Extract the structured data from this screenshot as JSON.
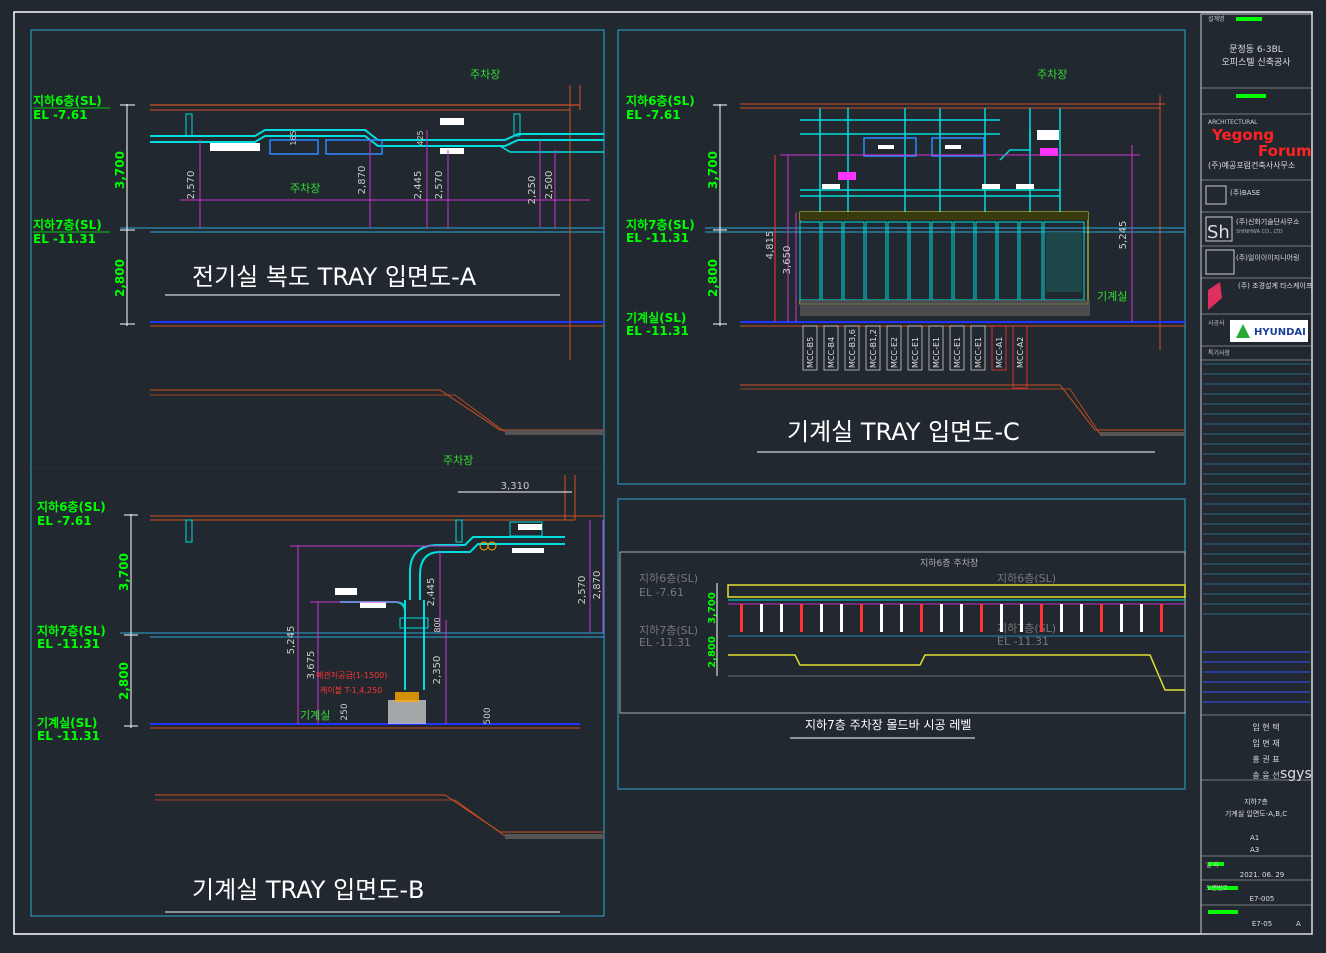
{
  "panelA": {
    "title": "전기실 복도 TRAY 입면도-A",
    "top_label": "주차장",
    "mid_label": "주차장",
    "level1": "지하6층(SL)",
    "el1": "EL -7.61",
    "level2": "지하7층(SL)",
    "el2": "EL -11.31",
    "dim_v1": "3,700",
    "dim_v2": "2,800",
    "dims": [
      "2,570",
      "2,870",
      "2,445",
      "2,570",
      "2,250",
      "2,500"
    ],
    "small_dims": [
      "165",
      "425"
    ]
  },
  "panelB": {
    "title": "기계실 TRAY 입면도-B",
    "top_label": "주차장",
    "level1": "지하6층(SL)",
    "el1": "EL -7.61",
    "level2": "지하7층(SL)",
    "el2": "EL -11.31",
    "level3": "기계실(SL)",
    "el3": "EL -11.31",
    "dim_v1": "3,700",
    "dim_v2": "2,800",
    "dim_top": "3,310",
    "dims": [
      "5,245",
      "3,675",
      "2,445",
      "2,350",
      "2,570",
      "2,870",
      "800",
      "500",
      "250"
    ],
    "room_label": "기계실",
    "notes": [
      "배관저공급(1-1500)",
      "케이블 T-1,4,250"
    ]
  },
  "panelC": {
    "title": "기계실 TRAY 입면도-C",
    "top_label": "주차장",
    "level1": "지하6층(SL)",
    "el1": "EL -7.61",
    "level2": "지하7층(SL)",
    "el2": "EL -11.31",
    "level3": "기계실(SL)",
    "el3": "EL -11.31",
    "dim_v1": "3,700",
    "dim_v2": "2,800",
    "dims": [
      "4,815",
      "3,650",
      "5,245"
    ],
    "room_label": "기계실",
    "mcc": [
      "MCC-B5",
      "MCC-B4",
      "MCC-B3,6",
      "MCC-B1,2",
      "MCC-E2",
      "MCC-E1",
      "MCC-E1",
      "MCC-E1",
      "MCC-E1",
      "MCC-A1",
      "MCC-A2"
    ]
  },
  "panelD": {
    "title": "지하7층 주차장 몰드바 시공 레벨",
    "top_label": "지하6층 주차장",
    "left_level1": "지하6층(SL)",
    "left_el1": "EL -7.61",
    "left_level2": "지하7층(SL)",
    "left_el2": "EL -11.31",
    "right_level1": "지하6층(SL)",
    "right_level2": "지하7층(SL)",
    "right_el2": "EL -11.31",
    "dim_v1": "3,700",
    "dim_v2": "2,800"
  },
  "titleblock": {
    "project_tag": "설계명",
    "project": [
      "문정동 6-3BL",
      "오피스텔 신축공사"
    ],
    "architect_tag": "ARCHITECTURAL",
    "architect_logo": [
      "Yegong",
      "Forum"
    ],
    "architect": "(주)예공포럼건축사사무소",
    "base_firm": "(주)BASE",
    "sh_firm": "(주)신화기술단사무소",
    "sh_sub": "SHINHWA CO., LTD",
    "firm3": "(주)일이이이지니어링",
    "firm4": "(주) 조경설계 타스케이프",
    "builder_tag": "시공사",
    "builder": "HYUNDAI",
    "notes_tag": "특기사항",
    "people": [
      "임 현 택",
      "임 면 재",
      "홍 권 표",
      "송 웅 선"
    ],
    "sign": "sgys",
    "drawing_title": [
      "지하7층",
      "기계실 입면도-A,B,C"
    ],
    "scale": [
      "A1",
      "A3"
    ],
    "date_label": "일 자",
    "date": "2021. 06. 29",
    "dwg_no_label": "도면번호",
    "dwg_no": "E7-005",
    "sheet": "E7-05",
    "rev": "A"
  },
  "colors": {
    "background": "#212830",
    "level_text": "#00ff00",
    "tray": "#00dddd",
    "dim": "#cc33cc",
    "slab": "#1a1aff"
  }
}
